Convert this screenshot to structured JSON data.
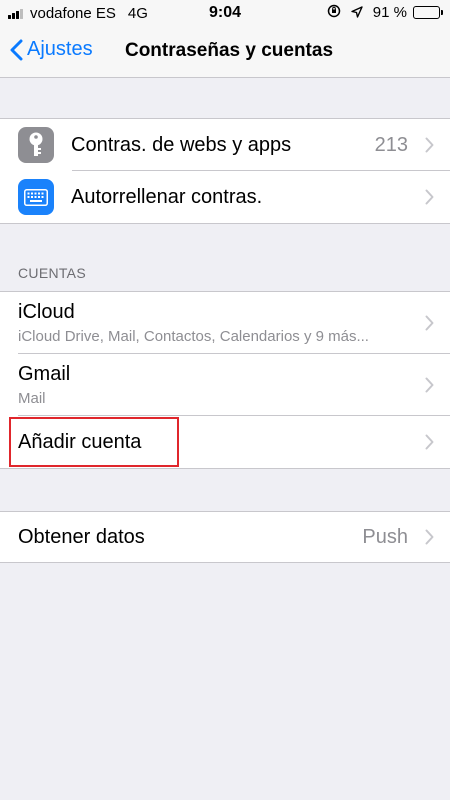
{
  "status_bar": {
    "carrier": "vodafone ES",
    "network": "4G",
    "time": "9:04",
    "battery": "91 %",
    "battery_level": 0.91
  },
  "nav": {
    "back_label": "Ajustes",
    "title": "Contraseñas y cuentas"
  },
  "passwords_group": {
    "items": [
      {
        "label": "Contras. de webs y apps",
        "detail": "213",
        "icon": "key-icon",
        "icon_color": "#8e8e93"
      },
      {
        "label": "Autorrellenar contras.",
        "detail": "",
        "icon": "keyboard-icon",
        "icon_color": "#1a82fb"
      }
    ]
  },
  "accounts": {
    "header": "CUENTAS",
    "items": [
      {
        "label": "iCloud",
        "sub": "iCloud Drive, Mail, Contactos, Calendarios y 9 más..."
      },
      {
        "label": "Gmail",
        "sub": "Mail"
      },
      {
        "label": "Añadir cuenta",
        "sub": ""
      }
    ]
  },
  "fetch": {
    "label": "Obtener datos",
    "detail": "Push"
  },
  "colors": {
    "accent": "#0a7aff",
    "highlight": "#e0262c",
    "background": "#efeff4"
  }
}
